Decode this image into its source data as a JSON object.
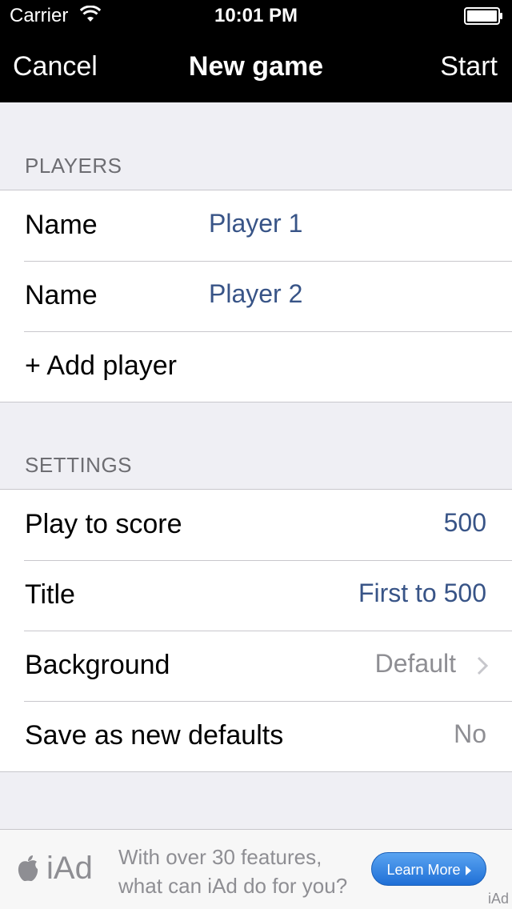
{
  "status_bar": {
    "carrier": "Carrier",
    "time": "10:01 PM"
  },
  "nav": {
    "left": "Cancel",
    "title": "New game",
    "right": "Start"
  },
  "players_section": {
    "header": "PLAYERS",
    "rows": [
      {
        "label": "Name",
        "value": "Player 1"
      },
      {
        "label": "Name",
        "value": "Player 2"
      }
    ],
    "add_label": "+ Add player"
  },
  "settings_section": {
    "header": "SETTINGS",
    "rows": [
      {
        "label": "Play to score",
        "value": "500"
      },
      {
        "label": "Title",
        "value": "First to 500"
      },
      {
        "label": "Background",
        "value": "Default"
      },
      {
        "label": "Save as new defaults",
        "value": "No"
      }
    ]
  },
  "ad": {
    "brand": "iAd",
    "line1": "With over 30 features,",
    "line2": "what can iAd do for you?",
    "button": "Learn More",
    "corner": "iAd"
  },
  "colors": {
    "bar_background": "#000000",
    "table_background": "#efeff4",
    "value_blue": "#385487",
    "value_gray": "#8e8e93"
  },
  "icons": [
    "wifi-icon",
    "battery-icon",
    "chevron-right-icon",
    "apple-logo-icon"
  ]
}
